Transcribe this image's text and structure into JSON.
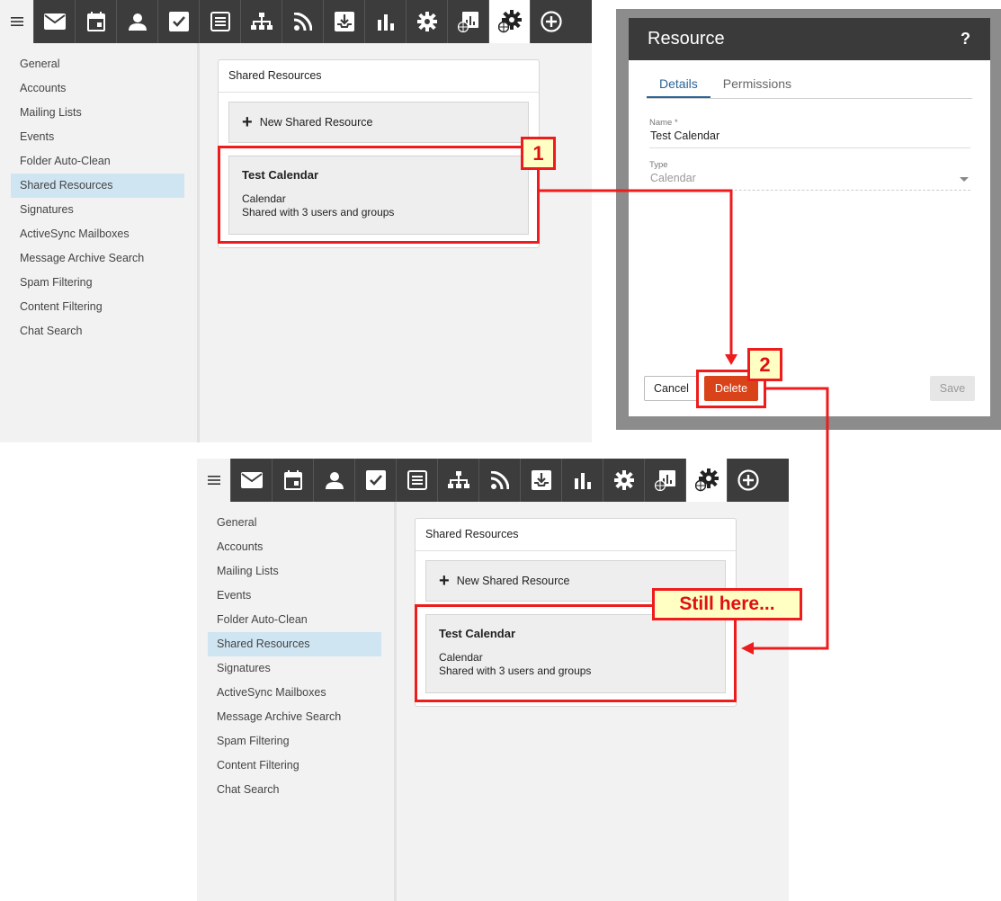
{
  "toolbar": {
    "menu_icon": "hamburger-icon",
    "buttons": [
      {
        "icon": "mail-icon"
      },
      {
        "icon": "calendar-icon"
      },
      {
        "icon": "person-icon"
      },
      {
        "icon": "checkbox-icon"
      },
      {
        "icon": "notes-icon"
      },
      {
        "icon": "sitemap-icon"
      },
      {
        "icon": "rss-icon"
      },
      {
        "icon": "archive-download-icon"
      },
      {
        "icon": "bar-chart-icon"
      },
      {
        "icon": "gear-icon"
      },
      {
        "icon": "globe-report-icon"
      },
      {
        "icon": "globe-gear-icon",
        "active": true
      },
      {
        "icon": "plus-circle-icon"
      }
    ]
  },
  "sidebar": {
    "items": [
      {
        "label": "General"
      },
      {
        "label": "Accounts"
      },
      {
        "label": "Mailing Lists"
      },
      {
        "label": "Events"
      },
      {
        "label": "Folder Auto-Clean"
      },
      {
        "label": "Shared Resources",
        "selected": true
      },
      {
        "label": "Signatures"
      },
      {
        "label": "ActiveSync Mailboxes"
      },
      {
        "label": "Message Archive Search"
      },
      {
        "label": "Spam Filtering"
      },
      {
        "label": "Content Filtering"
      },
      {
        "label": "Chat Search"
      }
    ]
  },
  "panel": {
    "title": "Shared Resources",
    "new_button": "New Shared Resource",
    "resource": {
      "name": "Test Calendar",
      "type": "Calendar",
      "shared": "Shared with 3 users and groups"
    }
  },
  "dialog": {
    "title": "Resource",
    "help": "?",
    "tabs": [
      "Details",
      "Permissions"
    ],
    "name_label": "Name *",
    "name_value": "Test Calendar",
    "type_label": "Type",
    "type_value": "Calendar",
    "cancel": "Cancel",
    "delete": "Delete",
    "save": "Save"
  },
  "annotations": {
    "step1": "1",
    "step2": "2",
    "note": "Still here...",
    "color": "#ee1c1c"
  }
}
